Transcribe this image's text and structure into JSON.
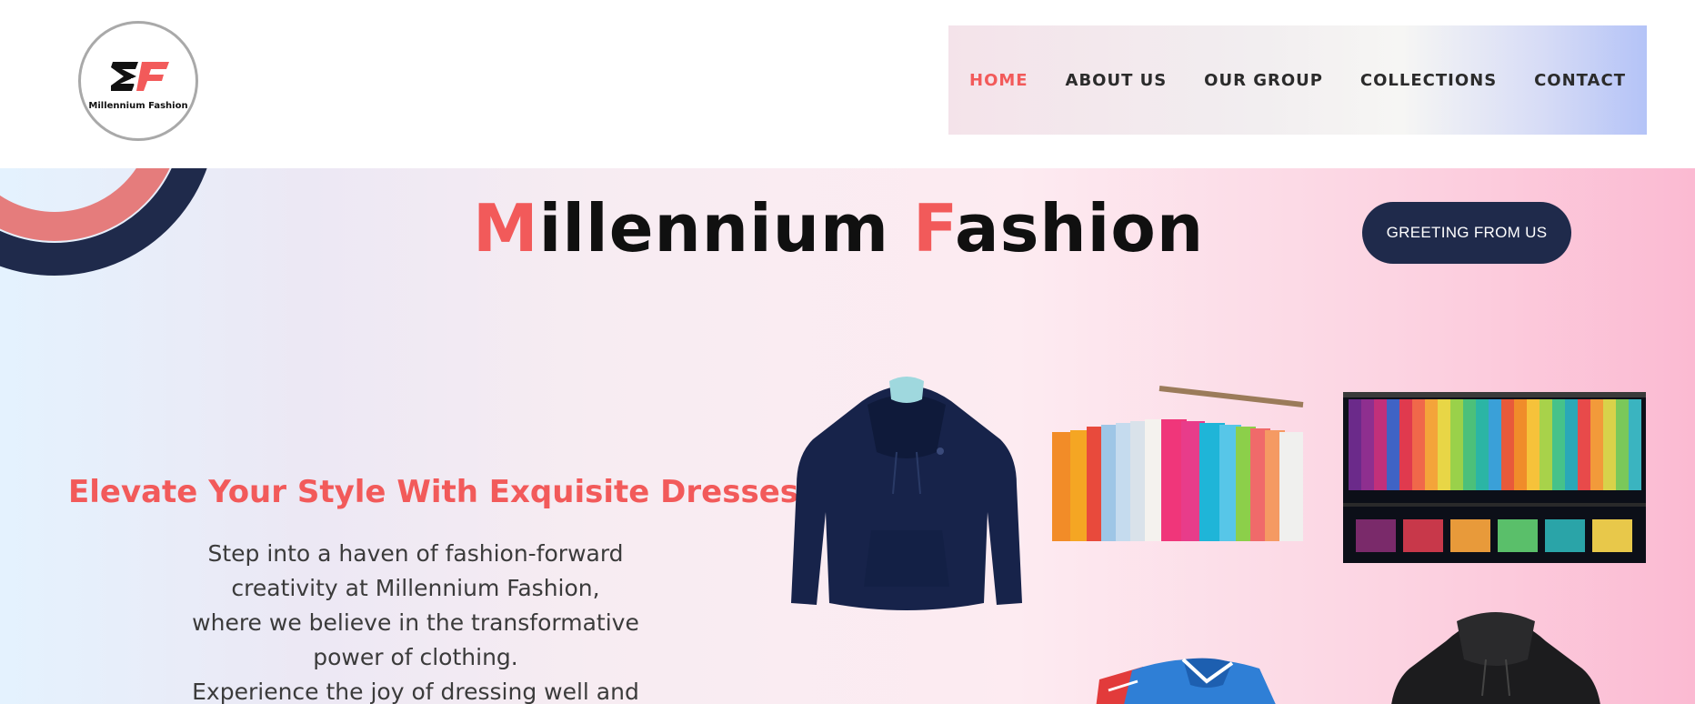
{
  "header": {
    "logo": {
      "brand_text": "Millennium Fashion",
      "mark_icon": "mf-monogram-icon"
    },
    "nav": [
      {
        "label": "HOME",
        "active": true
      },
      {
        "label": "ABOUT US",
        "active": false
      },
      {
        "label": "OUR GROUP",
        "active": false
      },
      {
        "label": "COLLECTIONS",
        "active": false
      },
      {
        "label": "CONTACT",
        "active": false
      }
    ]
  },
  "hero": {
    "title_parts": {
      "cap1": "M",
      "rest1": "illennium",
      "cap2": "F",
      "rest2": "ashion"
    },
    "greeting_button": "GREETING FROM US",
    "tagline": "Elevate Your Style With Exquisite Dresses",
    "description_lines": [
      "Step into a haven of fashion-forward",
      "creativity at Millennium Fashion,",
      "where we believe in the transformative",
      "power of clothing.",
      "Experience the joy of dressing well and"
    ],
    "images": [
      "navy-hoodie",
      "colorful-shirts-rack",
      "colorful-shirts-closet",
      "polo-shirts-stack",
      "black-hoodie"
    ]
  },
  "colors": {
    "accent": "#f25a5a",
    "navy": "#1f2a4b",
    "text_dark": "#2b2b2b"
  }
}
